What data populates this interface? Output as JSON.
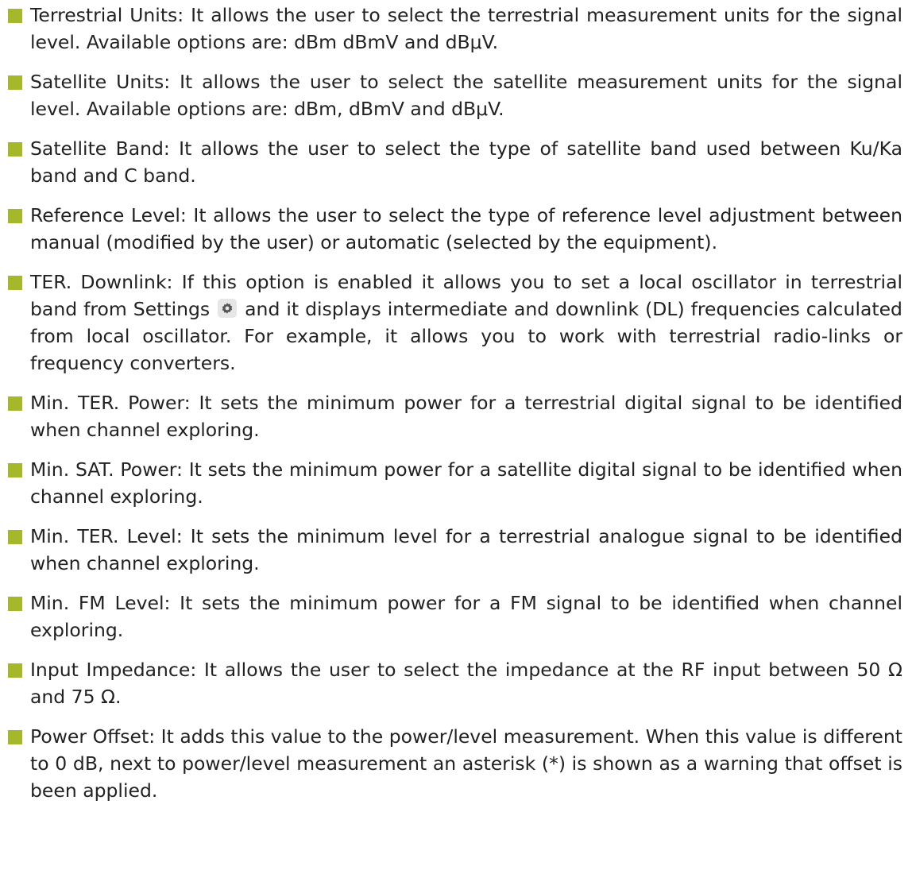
{
  "items": [
    {
      "text": "Terrestrial Units: It allows the user to select the terrestrial measurement units for the signal level. Available options are: dBm dBmV and dBμV."
    },
    {
      "text": "Satellite Units: It allows the user to select the satellite measurement units for the signal level. Available options are: dBm, dBmV and dBμV."
    },
    {
      "text": "Satellite Band: It allows the user to select the type of satellite band used between Ku/Ka band and C band."
    },
    {
      "text": "Reference Level: It allows the user to select the type of reference level adjustment between manual (modified by the user) or automatic (selected by the equipment)."
    },
    {
      "text_before_icon": "TER. Downlink: If this option is enabled it allows you to set a local oscillator in terrestrial band from Settings",
      "icon": "gear-icon",
      "text_after_icon": "and it displays intermediate and downlink (DL) frequencies calculated from local oscillator. For example, it allows you to work with terrestrial radio-links or frequency converters."
    },
    {
      "text": "Min. TER. Power: It sets the minimum power for a terrestrial digital signal to be identified when channel exploring."
    },
    {
      "text": "Min. SAT. Power: It sets the minimum power for a satellite digital signal to be identified when channel exploring."
    },
    {
      "text": "Min. TER. Level: It sets the minimum level for a terrestrial analogue signal to be identified when channel exploring."
    },
    {
      "text": "Min. FM Level: It sets the minimum power for a FM signal to be identified when channel exploring."
    },
    {
      "text": "Input Impedance: It allows the user to select the impedance at the RF input between 50 Ω and 75 Ω."
    },
    {
      "text": "Power Offset: It adds this value to the power/level measurement. When this value is different to 0 dB, next to power/level measurement an asterisk (*) is shown as a warning that offset is been applied."
    }
  ],
  "colors": {
    "bullet": "#a5b82c",
    "text": "#222222"
  }
}
